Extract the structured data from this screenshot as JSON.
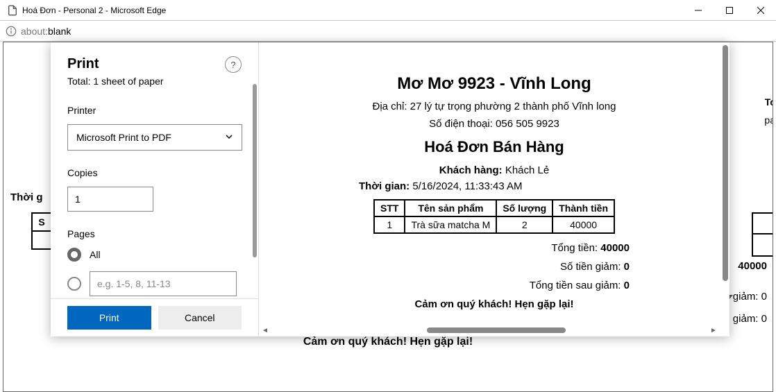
{
  "window": {
    "title": "Hoá Đơn - Personal 2 - Microsoft Edge"
  },
  "addressbar": {
    "prefix": "about:",
    "suffix": "blank"
  },
  "print_dialog": {
    "title": "Print",
    "subtitle": "Total: 1 sheet of paper",
    "help": "?",
    "printer_label": "Printer",
    "printer_value": "Microsoft Print to PDF",
    "copies_label": "Copies",
    "copies_value": "1",
    "pages_label": "Pages",
    "pages_all": "All",
    "pages_range_placeholder": "e.g. 1-5, 8, 11-13",
    "print_button": "Print",
    "cancel_button": "Cancel"
  },
  "invoice": {
    "store_name": "Mơ Mơ 9923 - Vĩnh Long",
    "address": "Địa chỉ: 27 lý tự trọng phường 2 thành phố Vĩnh long",
    "phone": "Số điện thoại: 056 505 9923",
    "heading": "Hoá Đơn Bán Hàng",
    "customer_label": "Khách hàng:",
    "customer_name": "Khách Lẻ",
    "time_label": "Thời gian:",
    "time_value": "5/16/2024, 11:33:43 AM",
    "table_headers": {
      "stt": "STT",
      "name": "Tên sản phẩm",
      "qty": "Số lượng",
      "amount": "Thành tiền"
    },
    "items": [
      {
        "stt": "1",
        "name": "Trà sữa matcha M",
        "qty": "2",
        "amount": "40000"
      }
    ],
    "total_label": "Tổng tiền:",
    "total_value": "40000",
    "discount_label": "Số tiền giảm:",
    "discount_value": "0",
    "after_label": "Tổng tiền sau giảm:",
    "after_value": "0",
    "thanks": "Cảm ơn quý khách! Hẹn gặp lại!"
  },
  "bg": {
    "time_label_short": "Thời g",
    "col_s": "S",
    "tc_frag": "Tc",
    "pa_frag": "pa",
    "total_40000": "40000",
    "discount_line": "giảm: 0",
    "after_line": "giảm: 0",
    "thanks": "Cảm ơn quý khách! Hẹn gặp lại!"
  }
}
